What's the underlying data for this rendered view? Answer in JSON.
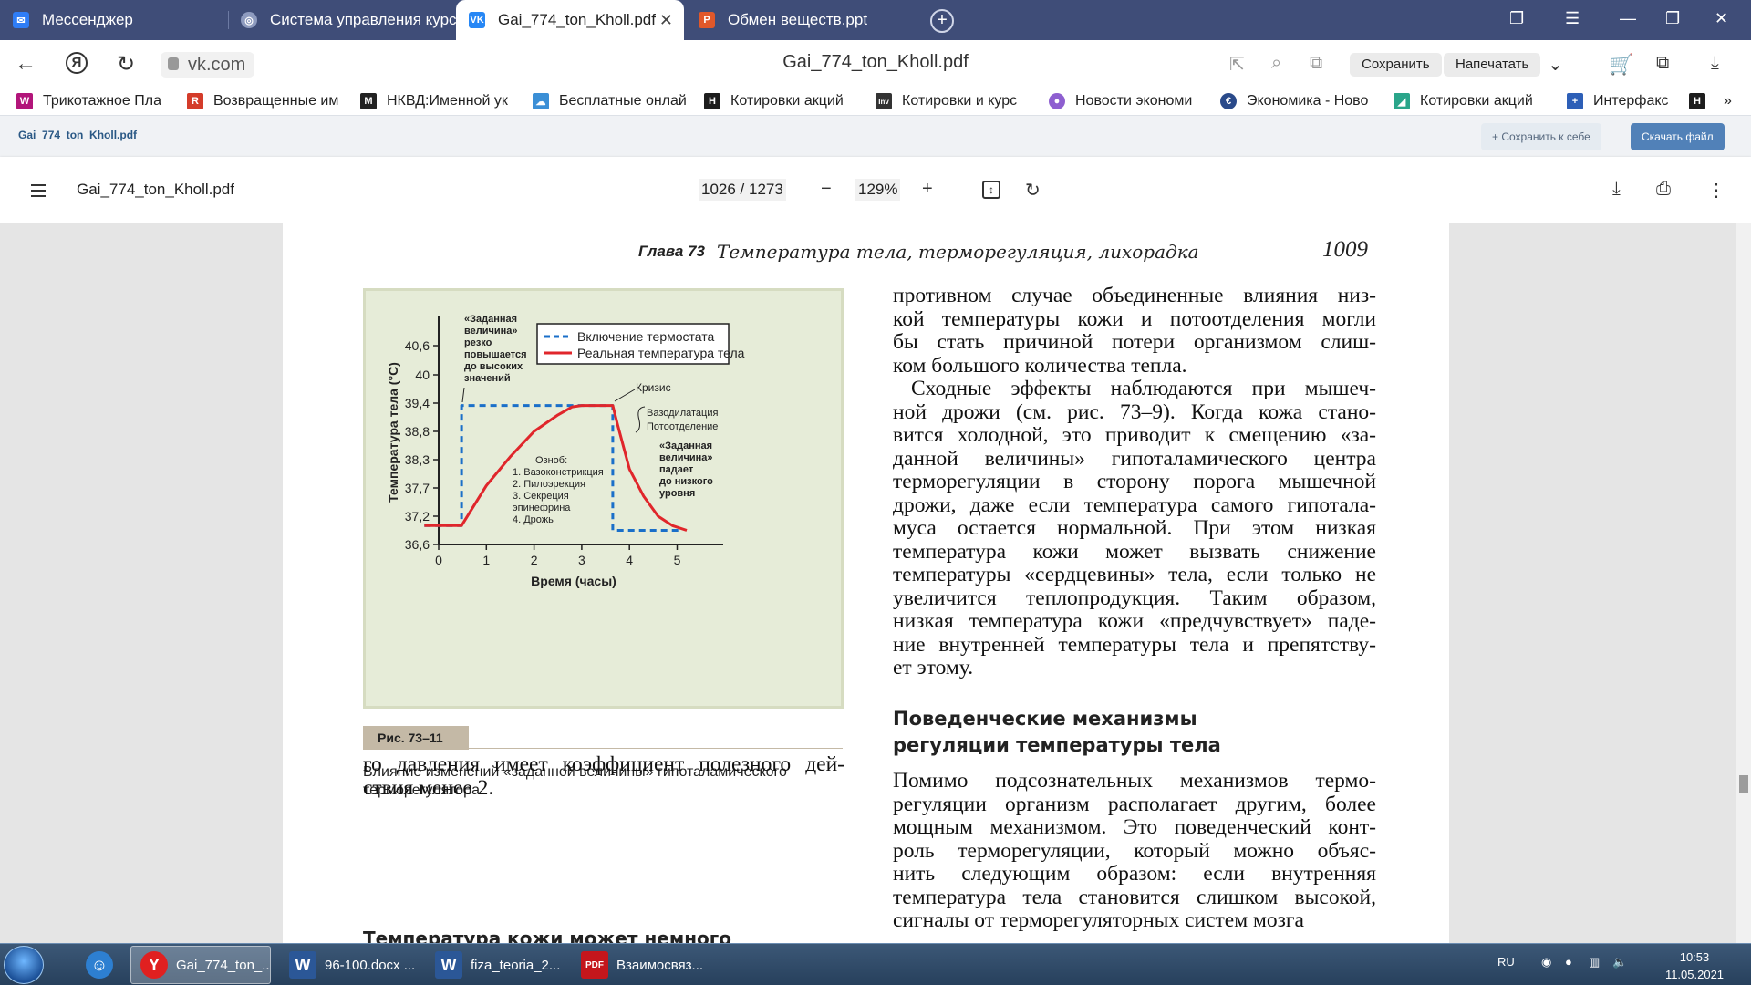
{
  "tabs": [
    {
      "label": "Мессенджер",
      "icon": "messenger-icon",
      "color": "#2f7df6"
    },
    {
      "label": "Система управления курс",
      "icon": "globe-icon",
      "color": "#8e9bbf"
    },
    {
      "label": "Gai_774_ton_Kholl.pdf",
      "icon": "vk-icon",
      "color": "#2787f5"
    },
    {
      "label": "Обмен веществ.ppt",
      "icon": "ppt-icon",
      "color": "#e0582a"
    }
  ],
  "address": {
    "url": "vk.com",
    "page_title": "Gai_774_ton_Kholl.pdf",
    "save_label": "Сохранить",
    "print_label": "Напечатать"
  },
  "bookmarks": [
    {
      "label": "Трикотажное Пла",
      "icon": "W",
      "color": "#b2157a"
    },
    {
      "label": "Возвращенные им",
      "icon": "R",
      "color": "#d43c2a"
    },
    {
      "label": "НКВД:Именной ук",
      "icon": "M",
      "color": "#222222"
    },
    {
      "label": "Бесплатные онлай",
      "icon": "☁",
      "color": "#3b8fd6"
    },
    {
      "label": "Котировки акций",
      "icon": "H",
      "color": "#1d1d1d"
    },
    {
      "label": "Котировки и курс",
      "icon": "Inv",
      "color": "#333333"
    },
    {
      "label": "Новости экономи",
      "icon": "●",
      "color": "#8e5fd0"
    },
    {
      "label": "Экономика - Ново",
      "icon": "€",
      "color": "#2a4a8a"
    },
    {
      "label": "Котировки акций",
      "icon": "◢",
      "color": "#2aa58a"
    },
    {
      "label": "Интерфакс",
      "icon": "+",
      "color": "#2d5fb7"
    }
  ],
  "vk": {
    "filename": "Gai_774_ton_Kholl.pdf",
    "save_to_self": "+ Сохранить к себе",
    "download": "Скачать файл"
  },
  "pdf": {
    "title": "Gai_774_ton_Kholl.pdf",
    "page_indicator": "1026 / 1273",
    "zoom": "129%"
  },
  "page": {
    "chapter": "Глава 73",
    "chapter_title": "Температура тела, терморегуляция, лихорадка",
    "page_number": "1009",
    "right_col_p1": [
      "противном случае объединенные влияния низ-",
      "кой температуры кожи и потоотделения могли",
      "бы стать причиной потери организмом слиш-",
      "ком большого количества тепла."
    ],
    "right_col_p2": [
      "Сходные эффекты наблюдаются при мышеч-",
      "ной дрожи (см. рис. 73–9). Когда кожа стано-",
      "вится холодной, это приводит к смещению «за-",
      "данной величины» гипоталамического центра",
      "терморегуляции в сторону порога мышечной",
      "дрожи, даже если температура самого гипотала-",
      "муса остается нормальной. При этом низкая",
      "температура кожи может вызвать снижение",
      "температуры «сердцевины» тела, если только не",
      "увеличится теплопродукция. Таким образом,",
      "низкая температура кожи «предчувствует» паде-",
      "ние внутренней температуры тела и препятству-",
      "ет этому."
    ],
    "section_heading": [
      "Поведенческие механизмы",
      "регуляции температуры тела"
    ],
    "right_col_p3": [
      "Помимо подсознательных механизмов термо-",
      "регуляции организм располагает другим, более",
      "мощным механизмом. Это поведенческий конт-",
      "роль терморегуляции, который можно объяс-",
      "нить следующим образом: если внутренняя",
      "температура тела становится слишком высокой,",
      "сигналы от терморегуляторных систем мозга"
    ],
    "left_col_text": [
      "го давления имеет коэффициент полезного дей-",
      "ствия менее 2."
    ],
    "left_heading_partial": "Температура кожи может немного",
    "figure_label": "Рис. 73–11",
    "figure_caption": "Влияние изменений «заданной величины» гипоталамического терморегулятора"
  },
  "chart_data": {
    "type": "line",
    "xlabel": "Время (часы)",
    "ylabel": "Температура тела (°C)",
    "x_ticks": [
      "0",
      "1",
      "2",
      "3",
      "4",
      "5"
    ],
    "y_ticks": [
      "36,6",
      "37,2",
      "37,7",
      "38,3",
      "38,8",
      "39,4",
      "40",
      "40,6"
    ],
    "xlim": [
      0,
      6
    ],
    "ylim": [
      36.6,
      41.0
    ],
    "legend": [
      "Включение термостата",
      "Реальная температура тела"
    ],
    "legend_position": "top-right",
    "series": [
      {
        "name": "Включение термостата",
        "style": "dashed",
        "color": "#1a6fc9",
        "points": [
          [
            -0.3,
            37.0
          ],
          [
            0.48,
            37.0
          ],
          [
            0.48,
            39.35
          ],
          [
            3.65,
            39.35
          ],
          [
            3.65,
            36.9
          ],
          [
            5.1,
            36.9
          ]
        ]
      },
      {
        "name": "Реальная температура тела",
        "style": "solid",
        "color": "#e0262b",
        "points": [
          [
            -0.3,
            37.0
          ],
          [
            0.48,
            37.0
          ],
          [
            1.0,
            37.75
          ],
          [
            1.5,
            38.35
          ],
          [
            2.0,
            38.8
          ],
          [
            2.5,
            39.15
          ],
          [
            2.8,
            39.32
          ],
          [
            3.0,
            39.35
          ],
          [
            3.65,
            39.35
          ],
          [
            3.75,
            38.95
          ],
          [
            4.0,
            38.1
          ],
          [
            4.3,
            37.55
          ],
          [
            4.6,
            37.2
          ],
          [
            4.9,
            37.0
          ],
          [
            5.2,
            36.9
          ]
        ]
      }
    ],
    "annotations": {
      "setpoint_up": [
        "«Заданная",
        "величина»",
        "резко",
        "повышается",
        "до высоких",
        "значений"
      ],
      "crisis": "Кризис",
      "vasodilation": [
        "Вазодилатация",
        "Потоотделение"
      ],
      "setpoint_down": [
        "«Заданная",
        "величина»",
        "падает",
        "до низкого",
        "уровня"
      ],
      "chills": [
        "Озноб:",
        "1. Вазоконстрикция",
        "2. Пилоэрекция",
        "3. Секреция",
        "    эпинефрина",
        "4. Дрожь"
      ]
    }
  },
  "taskbar": {
    "apps": [
      {
        "label": "Gai_774_ton_...",
        "icon": "Y",
        "color": "#e02020"
      },
      {
        "label": "96-100.docx ...",
        "icon": "W",
        "color": "#2b5797"
      },
      {
        "label": "fiza_teoria_2...",
        "icon": "W",
        "color": "#2b5797"
      },
      {
        "label": "Взаимосвяз...",
        "icon": "PDF",
        "color": "#c4161c"
      }
    ],
    "lang": "RU",
    "time": "10:53",
    "date": "11.05.2021"
  }
}
